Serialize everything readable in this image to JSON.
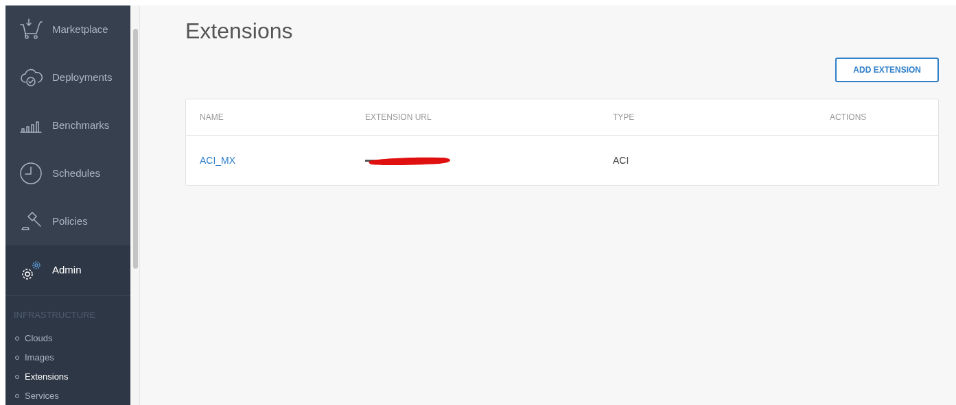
{
  "sidebar": {
    "items": [
      {
        "label": "Marketplace",
        "selected": false
      },
      {
        "label": "Deployments",
        "selected": false
      },
      {
        "label": "Benchmarks",
        "selected": false
      },
      {
        "label": "Schedules",
        "selected": false
      },
      {
        "label": "Policies",
        "selected": false
      },
      {
        "label": "Admin",
        "selected": true
      }
    ],
    "section": {
      "heading": "INFRASTRUCTURE",
      "items": [
        {
          "label": "Clouds",
          "selected": false
        },
        {
          "label": "Images",
          "selected": false
        },
        {
          "label": "Extensions",
          "selected": true
        },
        {
          "label": "Services",
          "selected": false
        }
      ]
    }
  },
  "page": {
    "title": "Extensions",
    "add_button": "ADD EXTENSION"
  },
  "table": {
    "columns": [
      "NAME",
      "EXTENSION URL",
      "TYPE",
      "ACTIONS"
    ],
    "rows": [
      {
        "name": "ACI_MX",
        "url_redacted": true,
        "type": "ACI"
      }
    ]
  }
}
